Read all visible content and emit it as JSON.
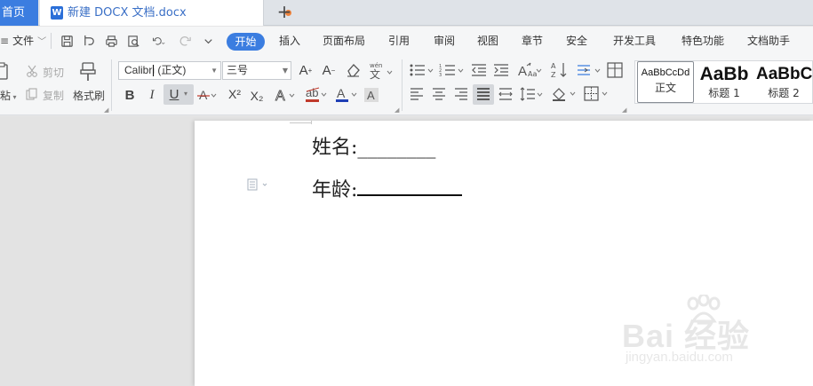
{
  "tabs": {
    "home_label": "首页",
    "doc_label": "新建 DOCX 文档.docx",
    "doc_icon_letter": "W",
    "new_tab_symbol": "+"
  },
  "menu": {
    "file_label": "文件",
    "active_tab": "开始",
    "tabs": [
      "插入",
      "页面布局",
      "引用",
      "审阅",
      "视图",
      "章节",
      "安全",
      "开发工具",
      "特色功能",
      "文档助手"
    ]
  },
  "ribbon": {
    "paste_label": "粘",
    "cut_label": "剪切",
    "copy_label": "复制",
    "format_painter_label": "格式刷",
    "font_name": "Calibri (正文)",
    "font_size": "三号",
    "bold": "B",
    "italic": "I",
    "underline": "U",
    "superscript": "X²",
    "subscript": "X₂",
    "styles": [
      {
        "preview": "AaBbCcDd",
        "caption": "正文"
      },
      {
        "preview": "AaBb",
        "caption": "标题 1"
      },
      {
        "preview": "AaBbC",
        "caption": "标题 2"
      }
    ]
  },
  "document": {
    "line1": {
      "label": "姓名:",
      "blank": "________"
    },
    "line2": {
      "label": "年龄:"
    }
  },
  "watermark": {
    "main": "Bai 经验",
    "sub": "jingyan.baidu.com"
  }
}
